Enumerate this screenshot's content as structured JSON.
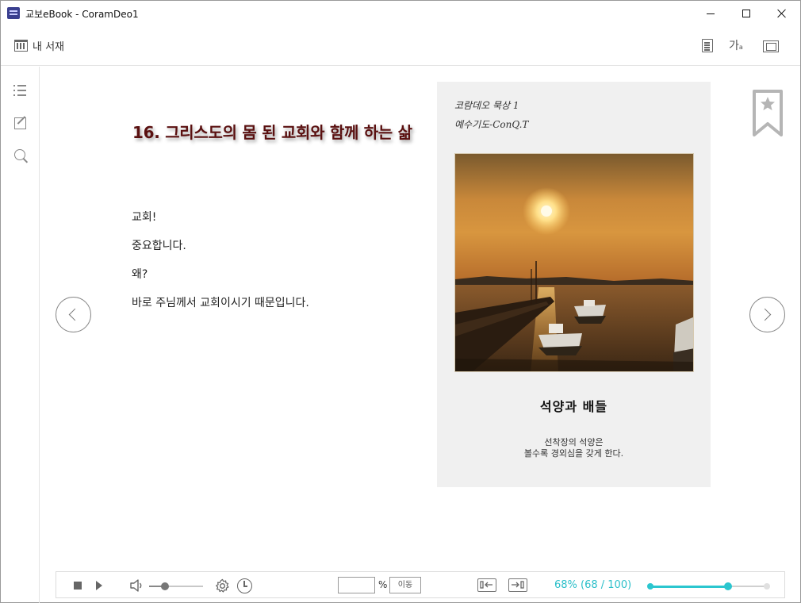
{
  "window": {
    "title": "교보eBook  -  CoramDeo1"
  },
  "toolbar": {
    "library_label": "내 서재",
    "font_icon_text": "가"
  },
  "page": {
    "chapter_title": "16. 그리스도의 몸 된 교회와 함께 하는 삶",
    "body_lines": [
      "교회!",
      "중요합니다.",
      "왜?",
      "바로 주님께서 교회이시기 때문입니다."
    ]
  },
  "image_page": {
    "hand_note_1": "코람데오 묵상 1",
    "hand_note_2": "예수기도-ConQ.T",
    "caption_title": "석양과 배들",
    "caption_line_1": "선착장의 석양은",
    "caption_line_2": "볼수록 경외심을 갖게 한다."
  },
  "bottombar": {
    "page_input_value": "",
    "percent_sign": "%",
    "go_label": "이동",
    "progress_text": "68% (68 / 100)",
    "progress": 0.68,
    "volume": 0.3
  },
  "colors": {
    "accent": "#2bc6cf",
    "title_color": "#5a1010"
  }
}
